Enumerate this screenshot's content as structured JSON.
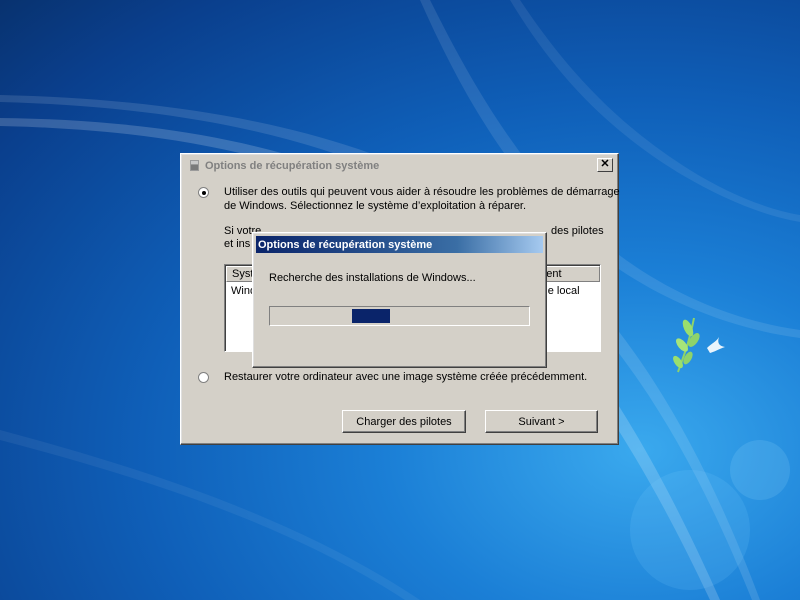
{
  "main_dialog": {
    "title": "Options de récupération système",
    "close_glyph": "✕",
    "option1_line1": "Utiliser des outils qui peuvent vous aider à résoudre les problèmes de démarrage",
    "option1_line2": "de Windows. Sélectionnez le système d’exploitation à réparer.",
    "info_line1_start": "Si votre",
    "info_line1_end": "des pilotes",
    "info_line2_start": "et ins",
    "list": {
      "headers": [
        "Syst",
        "ement"
      ],
      "row": [
        "Windo",
        "sque local"
      ]
    },
    "option2_label": "Restaurer votre ordinateur avec une image système créée précédemment.",
    "load_drivers_label": "Charger des pilotes",
    "next_label": "Suivant >"
  },
  "progress_dialog": {
    "title": "Options de récupération système",
    "message": "Recherche des installations de Windows...",
    "progress_marquee": true
  },
  "colors": {
    "dialog_face": "#d4d0c8",
    "title_active_start": "#0a246a",
    "title_active_end": "#a6caf0",
    "progress_chunk": "#0a246a",
    "desktop_blue": "#1b7fd6"
  },
  "icons": {
    "title_icon": "shield-icon"
  }
}
